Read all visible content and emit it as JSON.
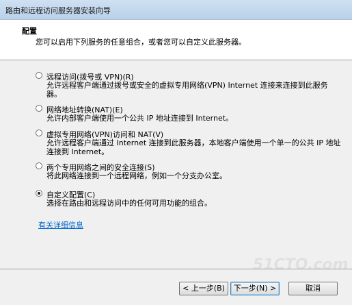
{
  "window": {
    "title": "路由和远程访问服务器安装向导"
  },
  "header": {
    "title": "配置",
    "subtitle": "您可以启用下列服务的任意组合，或者您可以自定义此服务器。"
  },
  "options": [
    {
      "label": "远程访问(拨号或 VPN)(R)",
      "description": "允许远程客户端通过拨号或安全的虚拟专用网络(VPN) Internet 连接来连接到此服务器。",
      "selected": false
    },
    {
      "label": "网络地址转换(NAT)(E)",
      "description": "允许内部客户端使用一个公共 IP 地址连接到 Internet。",
      "selected": false
    },
    {
      "label": "虚拟专用网络(VPN)访问和 NAT(V)",
      "description": "允许远程客户端通过 Internet 连接到此服务器，本地客户端使用一个单一的公共 IP 地址连接到 Internet。",
      "selected": false
    },
    {
      "label": "两个专用网络之间的安全连接(S)",
      "description": "将此网络连接到一个远程网络，例如一个分支办公室。",
      "selected": false
    },
    {
      "label": "自定义配置(C)",
      "description": "选择在路由和远程访问中的任何可用功能的组合。",
      "selected": true
    }
  ],
  "link": {
    "text": "有关详细信息"
  },
  "watermark": {
    "text": "51CTO.com"
  },
  "buttons": {
    "back": "< 上一步(B)",
    "next": "下一步(N) >",
    "cancel": "取消"
  }
}
